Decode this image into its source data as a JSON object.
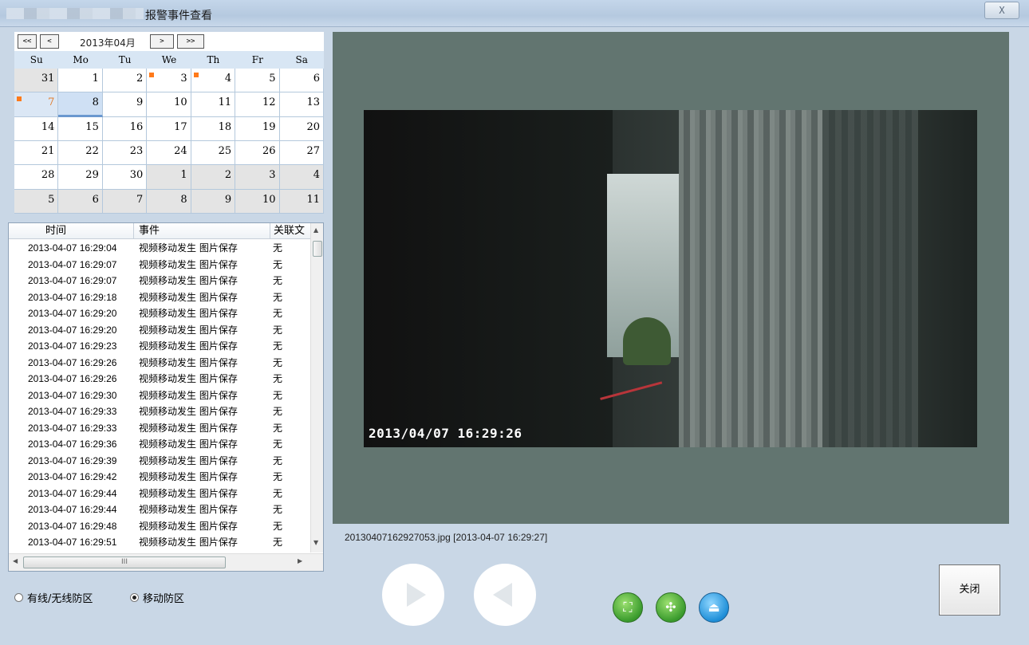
{
  "window": {
    "title": "报警事件查看",
    "close_glyph": "X"
  },
  "calendar": {
    "nav": {
      "first": "<<",
      "prev": "<",
      "next": ">",
      "last": ">>"
    },
    "month_label": "2013年04月",
    "weekdays": [
      "Su",
      "Mo",
      "Tu",
      "We",
      "Th",
      "Fr",
      "Sa"
    ],
    "days": [
      [
        {
          "d": "31",
          "other": true
        },
        {
          "d": "1"
        },
        {
          "d": "2"
        },
        {
          "d": "3",
          "mark": true
        },
        {
          "d": "4",
          "mark": true
        },
        {
          "d": "5"
        },
        {
          "d": "6"
        }
      ],
      [
        {
          "d": "7",
          "mark": true,
          "today": true
        },
        {
          "d": "8",
          "selected": true
        },
        {
          "d": "9"
        },
        {
          "d": "10"
        },
        {
          "d": "11"
        },
        {
          "d": "12"
        },
        {
          "d": "13"
        }
      ],
      [
        {
          "d": "14"
        },
        {
          "d": "15"
        },
        {
          "d": "16"
        },
        {
          "d": "17"
        },
        {
          "d": "18"
        },
        {
          "d": "19"
        },
        {
          "d": "20"
        }
      ],
      [
        {
          "d": "21"
        },
        {
          "d": "22"
        },
        {
          "d": "23"
        },
        {
          "d": "24"
        },
        {
          "d": "25"
        },
        {
          "d": "26"
        },
        {
          "d": "27"
        }
      ],
      [
        {
          "d": "28"
        },
        {
          "d": "29"
        },
        {
          "d": "30"
        },
        {
          "d": "1",
          "other": true
        },
        {
          "d": "2",
          "other": true
        },
        {
          "d": "3",
          "other": true
        },
        {
          "d": "4",
          "other": true
        }
      ],
      [
        {
          "d": "5",
          "other": true
        },
        {
          "d": "6",
          "other": true
        },
        {
          "d": "7",
          "other": true
        },
        {
          "d": "8",
          "other": true
        },
        {
          "d": "9",
          "other": true
        },
        {
          "d": "10",
          "other": true
        },
        {
          "d": "11",
          "other": true
        }
      ]
    ],
    "mark_color": "#ff7a1a"
  },
  "event_list": {
    "headers": [
      "时间",
      "事件",
      "关联文"
    ],
    "rows": [
      [
        "2013-04-07 16:29:04",
        "视频移动发生 图片保存",
        "无"
      ],
      [
        "2013-04-07 16:29:07",
        "视频移动发生 图片保存",
        "无"
      ],
      [
        "2013-04-07 16:29:07",
        "视频移动发生 图片保存",
        "无"
      ],
      [
        "2013-04-07 16:29:18",
        "视频移动发生 图片保存",
        "无"
      ],
      [
        "2013-04-07 16:29:20",
        "视频移动发生 图片保存",
        "无"
      ],
      [
        "2013-04-07 16:29:20",
        "视频移动发生 图片保存",
        "无"
      ],
      [
        "2013-04-07 16:29:23",
        "视频移动发生 图片保存",
        "无"
      ],
      [
        "2013-04-07 16:29:26",
        "视频移动发生 图片保存",
        "无"
      ],
      [
        "2013-04-07 16:29:26",
        "视频移动发生 图片保存",
        "无"
      ],
      [
        "2013-04-07 16:29:30",
        "视频移动发生 图片保存",
        "无"
      ],
      [
        "2013-04-07 16:29:33",
        "视频移动发生 图片保存",
        "无"
      ],
      [
        "2013-04-07 16:29:33",
        "视频移动发生 图片保存",
        "无"
      ],
      [
        "2013-04-07 16:29:36",
        "视频移动发生 图片保存",
        "无"
      ],
      [
        "2013-04-07 16:29:39",
        "视频移动发生 图片保存",
        "无"
      ],
      [
        "2013-04-07 16:29:42",
        "视频移动发生 图片保存",
        "无"
      ],
      [
        "2013-04-07 16:29:44",
        "视频移动发生 图片保存",
        "无"
      ],
      [
        "2013-04-07 16:29:44",
        "视频移动发生 图片保存",
        "无"
      ],
      [
        "2013-04-07 16:29:48",
        "视频移动发生 图片保存",
        "无"
      ],
      [
        "2013-04-07 16:29:51",
        "视频移动发生 图片保存",
        "无"
      ]
    ],
    "hscroll_grip": "III"
  },
  "zones": {
    "wired_label": "有线/无线防区",
    "motion_label": "移动防区",
    "selected": "motion"
  },
  "viewer": {
    "timestamp_overlay": "2013/04/07 16:29:26",
    "caption": "20130407162927053.jpg  [2013-04-07 16:29:27]"
  },
  "controls": {
    "play_icon": "play-icon",
    "back_icon": "reverse-play-icon",
    "fit_icon": "fit-screen-icon",
    "shrink_icon": "shrink-icon",
    "upload_icon": "upload-icon",
    "close_label": "关闭"
  }
}
